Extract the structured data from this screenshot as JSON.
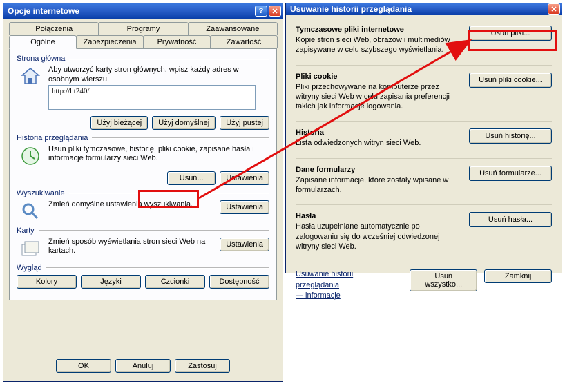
{
  "left": {
    "title": "Opcje internetowe",
    "tabs_top": [
      "Połączenia",
      "Programy",
      "Zaawansowane"
    ],
    "tabs_bottom": [
      "Ogólne",
      "Zabezpieczenia",
      "Prywatność",
      "Zawartość"
    ],
    "home": {
      "label": "Strona główna",
      "desc": "Aby utworzyć karty stron głównych, wpisz każdy adres w osobnym wierszu.",
      "address": "http://ht240/",
      "btn_current": "Użyj bieżącej",
      "btn_default": "Użyj domyślnej",
      "btn_blank": "Użyj pustej"
    },
    "history": {
      "label": "Historia przeglądania",
      "desc": "Usuń pliki tymczasowe, historię, pliki cookie, zapisane hasła i informacje formularzy sieci Web.",
      "btn_delete": "Usuń...",
      "btn_settings": "Ustawienia"
    },
    "search": {
      "label": "Wyszukiwanie",
      "desc": "Zmień domyślne ustawienia wyszukiwania.",
      "btn_settings": "Ustawienia"
    },
    "tabs_group": {
      "label": "Karty",
      "desc": "Zmień sposób wyświetlania stron sieci Web na kartach.",
      "btn_settings": "Ustawienia"
    },
    "appearance": {
      "label": "Wygląd",
      "btn_colors": "Kolory",
      "btn_languages": "Języki",
      "btn_fonts": "Czcionki",
      "btn_accessibility": "Dostępność"
    },
    "footer": {
      "ok": "OK",
      "cancel": "Anuluj",
      "apply": "Zastosuj"
    }
  },
  "right": {
    "title": "Usuwanie historii przeglądania",
    "sections": {
      "temp": {
        "h": "Tymczasowe pliki internetowe",
        "d": "Kopie stron sieci Web, obrazów i multimediów zapisywane w celu szybszego wyświetlania.",
        "btn": "Usuń pliki..."
      },
      "cookie": {
        "h": "Pliki cookie",
        "d": "Pliki przechowywane na komputerze przez witryny sieci Web w celu zapisania preferencji takich jak informacje logowania.",
        "btn": "Usuń pliki cookie..."
      },
      "hist": {
        "h": "Historia",
        "d": "Lista odwiedzonych witryn sieci Web.",
        "btn": "Usuń historię..."
      },
      "form": {
        "h": "Dane formularzy",
        "d": "Zapisane informacje, które zostały wpisane w formularzach.",
        "btn": "Usuń formularze..."
      },
      "pass": {
        "h": "Hasła",
        "d": "Hasła uzupełniane automatycznie po zalogowaniu się do wcześniej odwiedzonej witryny sieci Web.",
        "btn": "Usuń hasła..."
      }
    },
    "link1": "Usuwanie historii przeglądania",
    "link2": "— informacje",
    "btn_all": "Usuń wszystko...",
    "btn_close": "Zamknij"
  }
}
